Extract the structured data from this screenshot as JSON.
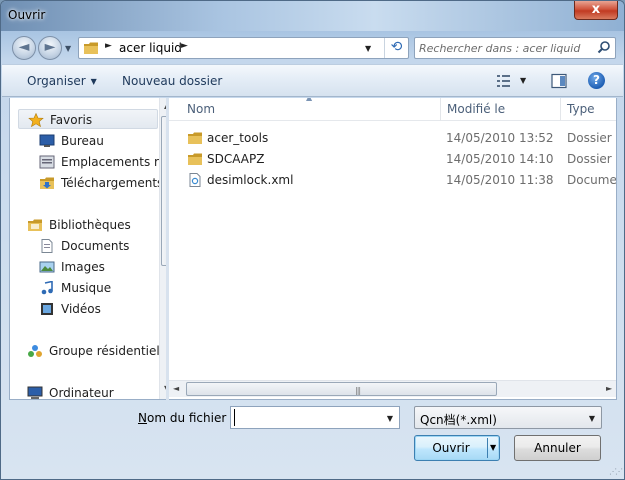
{
  "window": {
    "title": "Ouvrir",
    "close_label": "x"
  },
  "navigation": {
    "back_label": "◄",
    "forward_label": "►",
    "recent_label": "▼",
    "address_path": "acer liquid",
    "address_separator": "►",
    "address_dropdown": "▼",
    "refresh_label": "⟲",
    "search_placeholder": "Rechercher dans : acer liquid"
  },
  "toolbar": {
    "organise_label": "Organiser",
    "organise_caret": "▼",
    "new_folder_label": "Nouveau dossier",
    "views_dropdown": "▼",
    "help_label": "?"
  },
  "nav_pane": {
    "items": [
      {
        "label": "Favoris",
        "icon": "star-icon",
        "indent": 0,
        "selected": true
      },
      {
        "label": "Bureau",
        "icon": "desktop-icon",
        "indent": 1
      },
      {
        "label": "Emplacements ré",
        "icon": "recent-places-icon",
        "indent": 1
      },
      {
        "label": "Téléchargements",
        "icon": "downloads-folder-icon",
        "indent": 1
      },
      {
        "label": "Bibliothèques",
        "icon": "libraries-icon",
        "indent": 0
      },
      {
        "label": "Documents",
        "icon": "documents-icon",
        "indent": 1
      },
      {
        "label": "Images",
        "icon": "pictures-icon",
        "indent": 1
      },
      {
        "label": "Musique",
        "icon": "music-icon",
        "indent": 1
      },
      {
        "label": "Vidéos",
        "icon": "videos-icon",
        "indent": 1
      },
      {
        "label": "Groupe résidentiel",
        "icon": "homegroup-icon",
        "indent": 0
      },
      {
        "label": "Ordinateur",
        "icon": "computer-icon",
        "indent": 0
      }
    ],
    "scroll_up": "▲",
    "scroll_down": "▼"
  },
  "file_list": {
    "columns": {
      "name": "Nom",
      "modified": "Modifié le",
      "type": "Type"
    },
    "sort_indicator": "▲",
    "rows": [
      {
        "name": "acer_tools",
        "modified": "14/05/2010 13:52",
        "type": "Dossier de",
        "icon": "folder-icon"
      },
      {
        "name": "SDCAAPZ",
        "modified": "14/05/2010 14:10",
        "type": "Dossier de",
        "icon": "folder-icon"
      },
      {
        "name": "desimlock.xml",
        "modified": "14/05/2010 11:38",
        "type": "Documen",
        "icon": "xml-file-icon"
      }
    ],
    "hscroll_left": "◄",
    "hscroll_right": "►",
    "grip": "|||"
  },
  "footer": {
    "filename_label_access": "N",
    "filename_label_rest": "om du fichier :",
    "filename_value": "",
    "filename_dropdown": "▼",
    "filter_value": "Qcn档(*.xml)",
    "filter_dropdown": "▼",
    "open_label": "Ouvrir",
    "open_split_arrow": "▼",
    "cancel_label": "Annuler",
    "resize_grip": "⋰⋰"
  },
  "colors": {
    "folder": "#e8c15a",
    "folder_dark": "#c89a2a",
    "link_text": "#1e395b",
    "accent": "#3c7fb1"
  }
}
